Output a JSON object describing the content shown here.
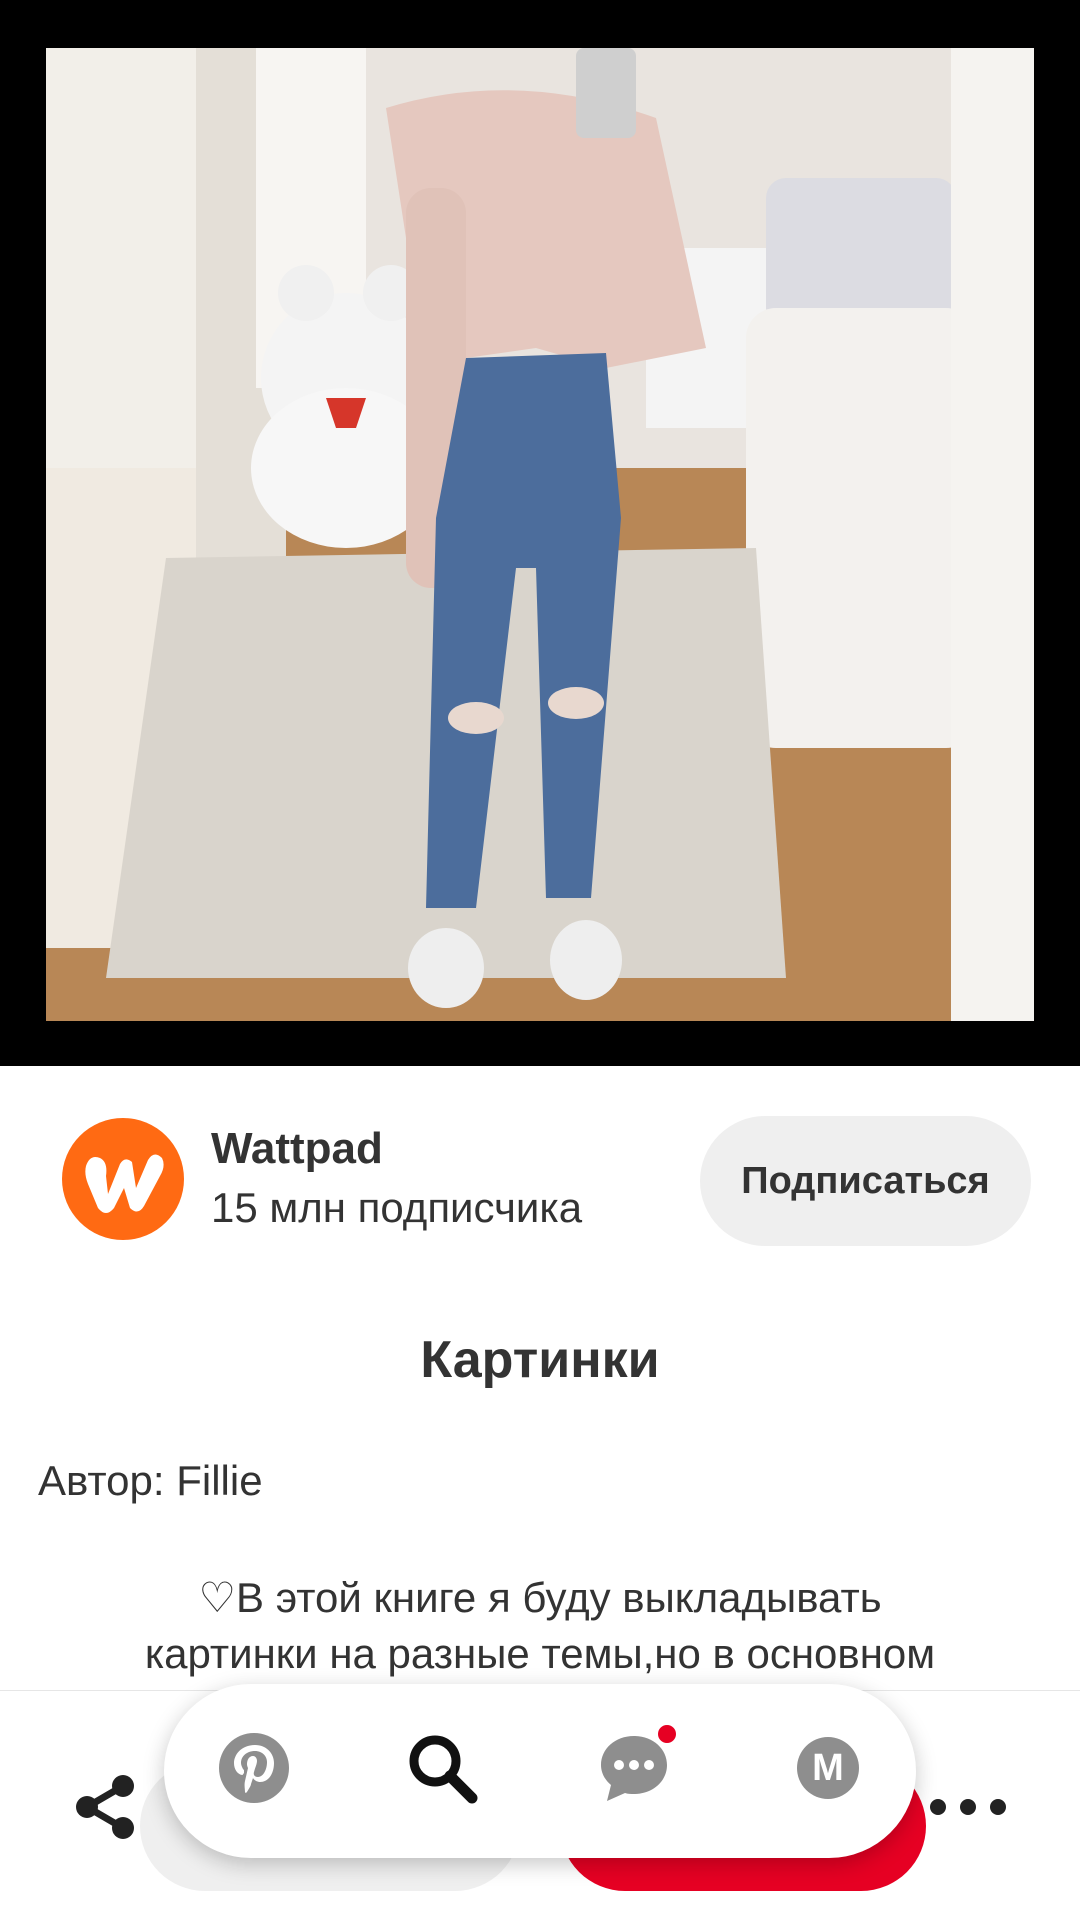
{
  "pin": {
    "image_alt": "Pin photo"
  },
  "creator": {
    "name": "Wattpad",
    "followers": "15 млн подписчика",
    "follow_label": "Подписаться",
    "avatar_icon": "wattpad-logo",
    "avatar_color": "#ff6a13"
  },
  "content": {
    "title": "Картинки",
    "author": "Автор: Fillie",
    "description_lines": [
      "♡В этой книге я буду выкладывать",
      "картинки на разные темы,но в основном"
    ]
  },
  "actions": {
    "share_icon": "share-icon",
    "more_icon": "more-icon",
    "save_color": "#e60023"
  },
  "nav": {
    "items": [
      {
        "icon": "pinterest-icon",
        "active": false
      },
      {
        "icon": "search-icon",
        "active": true
      },
      {
        "icon": "messages-icon",
        "active": false,
        "has_notification": true
      },
      {
        "icon": "profile-icon",
        "active": false,
        "initial": "M"
      }
    ]
  }
}
